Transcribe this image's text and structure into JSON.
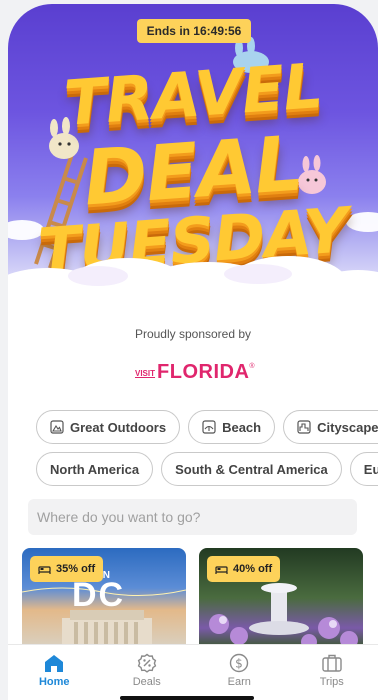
{
  "hero": {
    "timer": "Ends in 16:49:56",
    "title_lines": [
      "TRAVEL",
      "DEAL",
      "TUESDAY"
    ]
  },
  "sponsor": {
    "label": "Proudly sponsored by",
    "logo_small": "VISIT",
    "logo_main": "FLORIDA",
    "logo_mark": "®"
  },
  "categories": {
    "row1": [
      {
        "label": "Great Outdoors",
        "icon": "mountain-icon"
      },
      {
        "label": "Beach",
        "icon": "beach-icon"
      },
      {
        "label": "Cityscapes",
        "icon": "city-icon"
      }
    ],
    "row2": [
      {
        "label": "North America"
      },
      {
        "label": "South & Central America"
      },
      {
        "label": "Europ"
      }
    ]
  },
  "search": {
    "placeholder": "Where do you want to go?"
  },
  "deals": [
    {
      "discount": "35% off",
      "image_text": "WASHINGTON DC"
    },
    {
      "discount": "40% off"
    }
  ],
  "nav": [
    {
      "label": "Home",
      "icon": "home-icon",
      "active": true
    },
    {
      "label": "Deals",
      "icon": "deals-tag-icon",
      "active": false
    },
    {
      "label": "Earn",
      "icon": "dollar-coin-icon",
      "active": false
    },
    {
      "label": "Trips",
      "icon": "suitcase-icon",
      "active": false
    }
  ],
  "colors": {
    "accent": "#1e88d8",
    "badge": "#fdd25a",
    "brand": "#e0266d"
  }
}
